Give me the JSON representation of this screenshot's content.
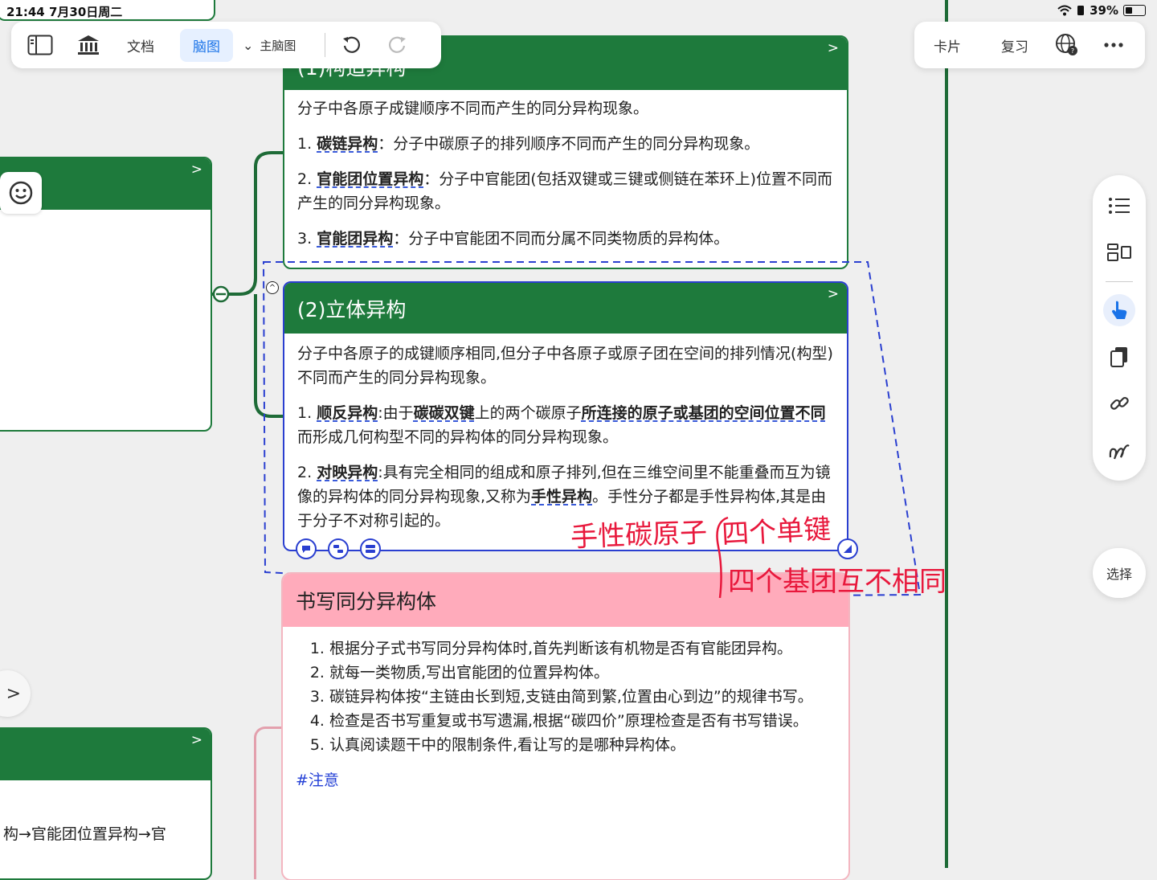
{
  "status": {
    "time": "21:44  7月30日周二",
    "battery": "39%"
  },
  "toolbar_left": {
    "doc_label": "文档",
    "mindmap_label": "脑图",
    "main_mindmap_label": "主脑图"
  },
  "toolbar_right": {
    "cards_label": "卡片",
    "review_label": "复习"
  },
  "select_label": "选择",
  "node_structural": {
    "title": "(1)构造异构",
    "intro": "分子中各原子成键顺序不同而产生的同分异构现象。",
    "items": [
      {
        "num": "1.",
        "term": "碳链异构",
        "sep": "：",
        "text": "分子中碳原子的排列顺序不同而产生的同分异构现象。"
      },
      {
        "num": "2.",
        "term": "官能团位置异构",
        "sep": "：",
        "text": "分子中官能团(包括双键或三键或侧链在苯环上)位置不同而产生的同分异构现象。"
      },
      {
        "num": "3.",
        "term": "官能团异构",
        "sep": "：",
        "text": "分子中官能团不同而分属不同类物质的异构体。"
      }
    ]
  },
  "node_stereo": {
    "title": "(2)立体异构",
    "intro": "分子中各原子的成键顺序相同,但分子中各原子或原子团在空间的排列情况(构型)不同而产生的同分异构现象。",
    "item1_num": "1.",
    "item1_term": "顺反异构",
    "item1_a": ":由于",
    "item1_b": "碳碳双键",
    "item1_c": "上的两个碳原子",
    "item1_d": "所连接的原子或基团的空间位置不同",
    "item1_e": "而形成几何构型不同的异构体的同分异构现象。",
    "item2_num": "2.",
    "item2_term": "对映异构",
    "item2_a": ":具有完全相同的组成和原子排列,但在三维空间里不能重叠而互为镜像的异构体的同分异构现象,又称为",
    "item2_b": "手性异构",
    "item2_c": "。手性分子都是手性异构体,其是由于分子不对称引起的。"
  },
  "handwriting": {
    "line1": "手性碳原子",
    "line2": "四个单键",
    "line3": "四个基团互不相同",
    "color": "#e8183c"
  },
  "node_writing": {
    "title": "书写同分异构体",
    "items": [
      "根据分子式书写同分异构体时,首先判断该有机物是否有官能团异构。",
      "就每一类物质,写出官能团的位置异构体。",
      "碳链异构体按“主链由长到短,支链由简到繁,位置由心到边”的规律书写。",
      "检查是否书写重复或书写遗漏,根据“碳四价”原理检查是否有书写错误。",
      "认真阅读题干中的限制条件,看让写的是哪种异构体。"
    ],
    "tag": "#注意"
  },
  "left_bottom_node": {
    "text": "构→官能团位置异构→官"
  },
  "colors": {
    "green": "#1e7a3c",
    "pink": "#ffabbb",
    "selection_blue": "#2a3fd0",
    "accent_blue": "#1a73e8"
  }
}
